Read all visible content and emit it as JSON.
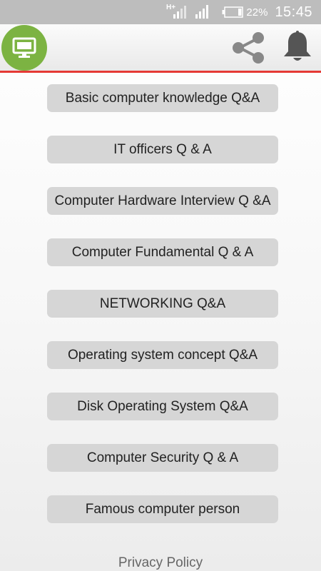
{
  "status_bar": {
    "network_type": "H+",
    "battery": "22%",
    "time": "15:45"
  },
  "app_bar": {
    "logo_icon": "computer-monitor-icon",
    "share_icon": "share-icon",
    "notification_icon": "bell-icon",
    "accent_color": "#e53935",
    "logo_color": "#7cb342"
  },
  "menu": {
    "items": [
      {
        "label": "Basic computer knowledge Q&A"
      },
      {
        "label": "IT officers Q & A"
      },
      {
        "label": "Computer Hardware Interview Q &A"
      },
      {
        "label": "Computer Fundamental Q & A"
      },
      {
        "label": "NETWORKING Q&A"
      },
      {
        "label": "Operating system concept Q&A"
      },
      {
        "label": "Disk Operating System Q&A"
      },
      {
        "label": "Computer Security Q & A"
      },
      {
        "label": "Famous computer person"
      }
    ]
  },
  "footer": {
    "privacy_label": "Privacy Policy"
  }
}
